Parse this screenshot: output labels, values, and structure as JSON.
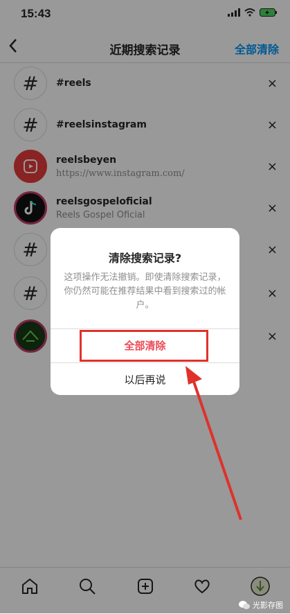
{
  "status": {
    "time": "15:43"
  },
  "header": {
    "title": "近期搜索记录",
    "clear_all": "全部清除",
    "back_icon": "chevron-left-icon"
  },
  "recents": [
    {
      "name": "#reels",
      "sub": "",
      "avatar": "hashtag"
    },
    {
      "name": "#reelsinstagram",
      "sub": "",
      "avatar": "hashtag"
    },
    {
      "name": "reelsbeyen",
      "sub": "https://www.instagram.com/",
      "avatar": "reels-logo"
    },
    {
      "name": "reelsgospeloficial",
      "sub": "Reels Gospel Oficial",
      "avatar": "tiktok-logo"
    },
    {
      "name": "",
      "sub": "",
      "avatar": "hashtag"
    },
    {
      "name": "",
      "sub": "",
      "avatar": "hashtag"
    },
    {
      "name": "",
      "sub": "",
      "avatar": "green-hornet"
    }
  ],
  "hash_glyph": "#",
  "close_glyph": "×",
  "dialog": {
    "title": "清除搜索记录?",
    "message": "这项操作无法撤销。即使清除搜索记录，你仍然可能在推荐结果中看到搜索过的帐户。",
    "confirm": "全部清除",
    "cancel": "以后再说"
  },
  "tabbar": [
    "home-icon",
    "search-icon",
    "new-post-icon",
    "heart-icon",
    "profile-avatar"
  ],
  "watermark": "光影存图",
  "colors": {
    "danger": "#ed4956",
    "link": "#0095f6",
    "annotation": "#e0312b"
  }
}
